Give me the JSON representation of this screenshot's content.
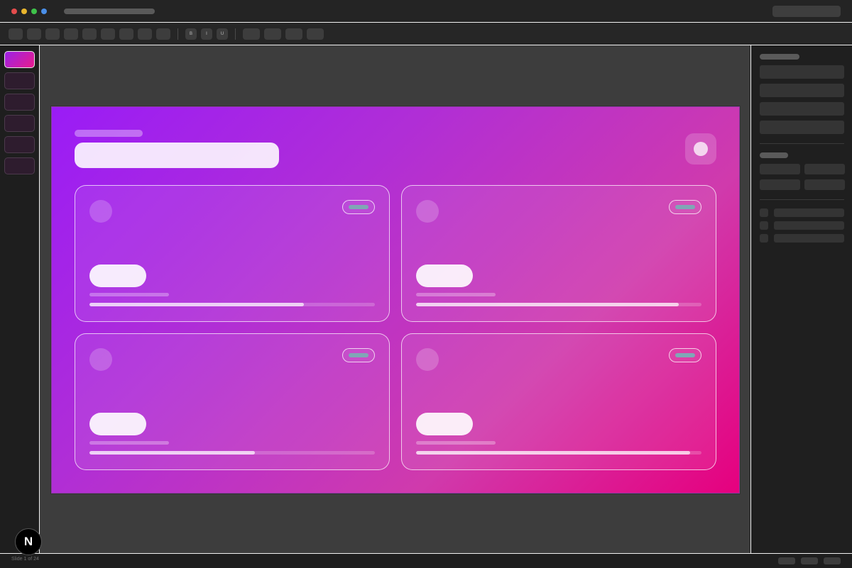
{
  "window": {
    "traffic_lights": [
      "#e34c4c",
      "#e8b52d",
      "#3ec24a",
      "#4a8fe8"
    ]
  },
  "toolbar": {
    "bold_label": "B",
    "italic_label": "I",
    "underline_label": "U"
  },
  "slide": {
    "gradient": [
      "#9a1cf6",
      "#e6007e"
    ],
    "cards": [
      {
        "progress": 0.75
      },
      {
        "progress": 0.92
      },
      {
        "progress": 0.58
      },
      {
        "progress": 0.96
      }
    ]
  },
  "status": {
    "slide_indicator": "Slide 1 of 24"
  },
  "logo": {
    "glyph": "N",
    "icon": "n-logo-icon"
  }
}
